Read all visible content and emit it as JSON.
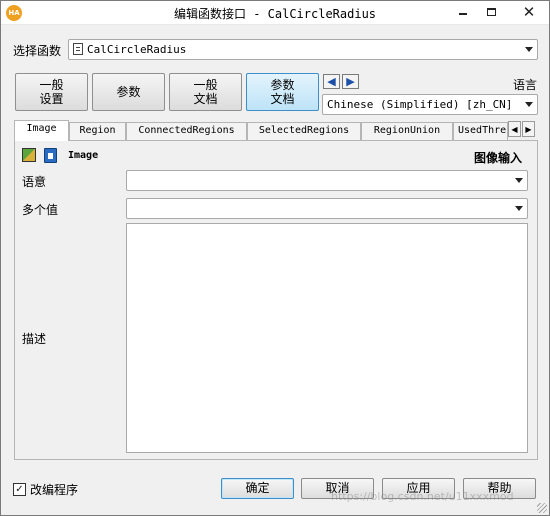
{
  "window": {
    "title": "编辑函数接口 - CalCircleRadius",
    "app_icon_text": "HA"
  },
  "controls": {
    "minimize_icon": "minimize-icon",
    "maximize_icon": "maximize-icon",
    "close_glyph": "✕"
  },
  "function_select": {
    "label": "选择函数",
    "value": "CalCircleRadius"
  },
  "toolbar": {
    "general_settings": "一般\n设置",
    "parameters": "参数",
    "general_docs": "一般\n文档",
    "parameter_docs": "参数\n文档",
    "active": "parameter_docs",
    "prev_glyph": "◀",
    "next_glyph": "▶"
  },
  "language": {
    "label": "语言",
    "value": "Chinese (Simplified) [zh_CN]"
  },
  "tabs": [
    {
      "label": "Image",
      "active": true
    },
    {
      "label": "Region",
      "active": false
    },
    {
      "label": "ConnectedRegions",
      "active": false
    },
    {
      "label": "SelectedRegions",
      "active": false
    },
    {
      "label": "RegionUnion",
      "active": false
    },
    {
      "label": "UsedThreshold",
      "active": false
    }
  ],
  "tab_scroll": {
    "left": "◀",
    "right": "▶"
  },
  "parameter": {
    "name": "Image",
    "kind": "图像输入",
    "semantics_label": "语意",
    "semantics_value": "",
    "multi_value_label": "多个值",
    "multi_value_value": "",
    "description_label": "描述",
    "description_value": ""
  },
  "footer": {
    "modify_program_label": "改编程序",
    "modify_program_checked": true,
    "check_glyph": "✓",
    "ok": "确定",
    "cancel": "取消",
    "apply": "应用",
    "help": "帮助",
    "watermark": "https://blog.csdn.net/u11xxxmod"
  },
  "colors": {
    "active_border": "#3c8fc8",
    "window_bg": "#f0f0f0"
  }
}
